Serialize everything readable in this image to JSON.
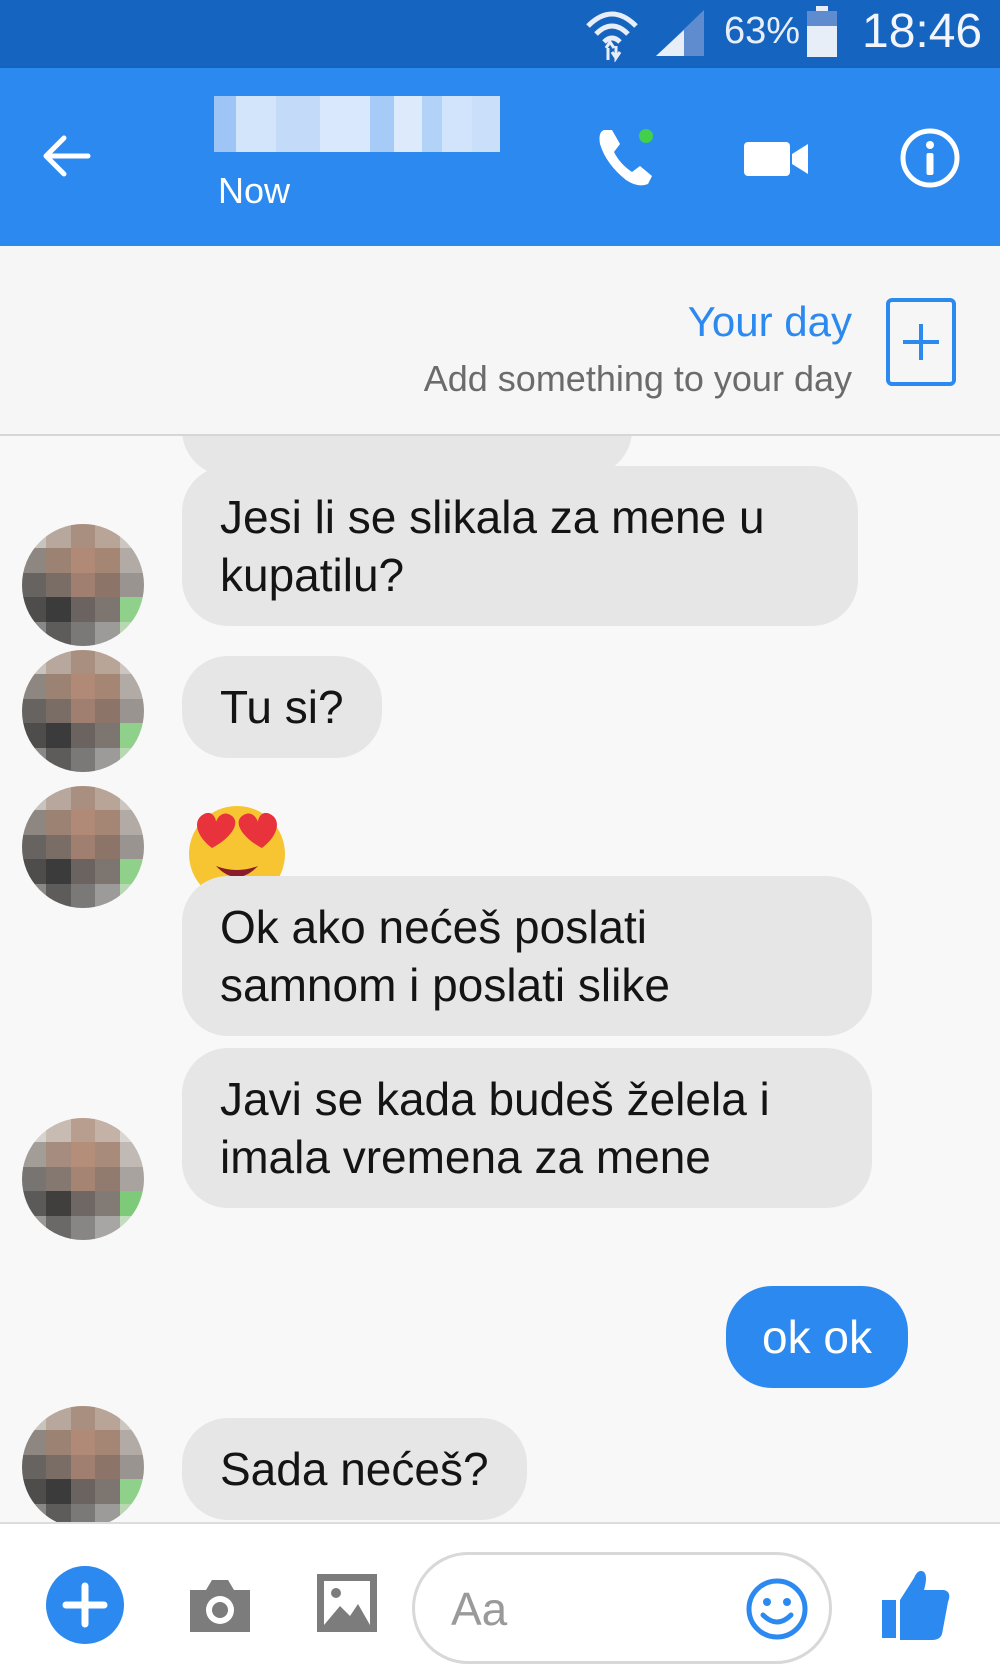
{
  "status_bar": {
    "battery": "63%",
    "time": "18:46"
  },
  "header": {
    "subtitle": "Now",
    "back_icon": "back-arrow-icon",
    "call_icon": "phone-call-icon",
    "video_icon": "video-camera-icon",
    "info_icon": "info-icon"
  },
  "your_day": {
    "title": "Your day",
    "subtitle": "Add something to your day"
  },
  "messages": [
    {
      "text": "Jesi li se slikala za mene u kupatilu?",
      "direction": "incoming"
    },
    {
      "text": "Tu si?",
      "direction": "incoming"
    },
    {
      "text": "😍",
      "direction": "incoming",
      "type": "emoji"
    },
    {
      "text": "Ok ako nećeš poslati samnom i poslati slike",
      "direction": "incoming"
    },
    {
      "text": "Javi se kada budeš želela i imala vremena za mene",
      "direction": "incoming"
    },
    {
      "text": "ok ok",
      "direction": "outgoing"
    },
    {
      "text": "Sada nećeš?",
      "direction": "incoming"
    }
  ],
  "composer": {
    "placeholder": "Aa"
  },
  "colors": {
    "brand": "#2b89f0",
    "status_bar": "#1565c0",
    "incoming_bubble": "#e6e6e6"
  }
}
